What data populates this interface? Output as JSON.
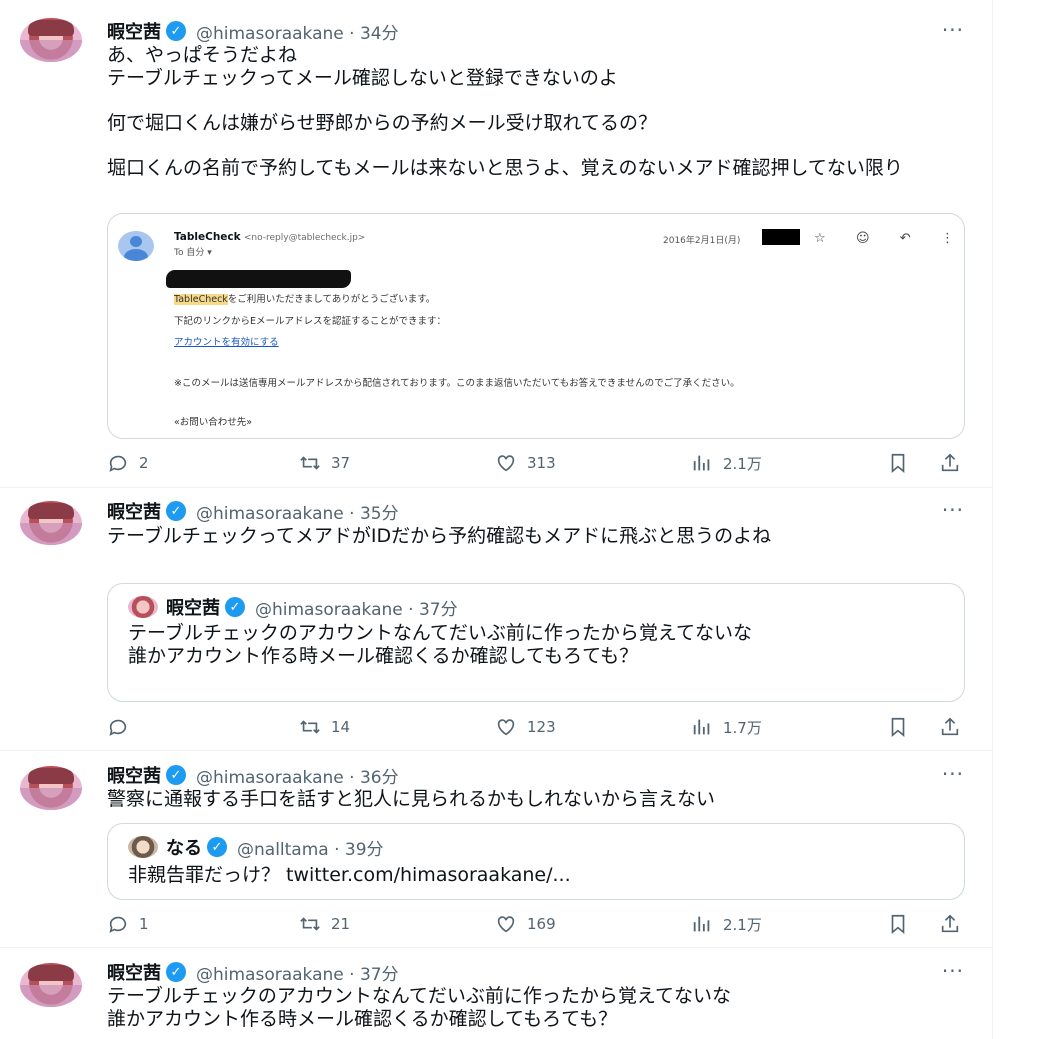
{
  "tweets": [
    {
      "name": "暇空茜",
      "verified": "✓",
      "handle": "@himasoraakane · 34分",
      "more": "···",
      "text": "あ、やっぱそうだよね\nテーブルチェックってメール確認しないと登録できないのよ\n\n何で堀口くんは嫌がらせ野郎からの予約メール受け取れてるの？\n\n堀口くんの名前で予約してもメールは来ないと思うよ、覚えのないメアド確認押してない限り",
      "replies": "2",
      "retweets": "37",
      "likes": "313",
      "views": "2.1万"
    },
    {
      "name": "暇空茜",
      "verified": "✓",
      "handle": "@himasoraakane · 35分",
      "more": "···",
      "text": "テーブルチェックってメアドがIDだから予約確認もメアドに飛ぶと思うのよね",
      "quote": {
        "name": "暇空茜",
        "handle": "@himasoraakane · 37分",
        "text": "テーブルチェックのアカウントなんてだいぶ前に作ったから覚えてないな\n誰かアカウント作る時メール確認くるか確認してもろても？"
      },
      "replies": "",
      "retweets": "14",
      "likes": "123",
      "views": "1.7万"
    },
    {
      "name": "暇空茜",
      "verified": "✓",
      "handle": "@himasoraakane · 36分",
      "more": "···",
      "text": "警察に通報する手口を話すと犯人に見られるかもしれないから言えない",
      "quote": {
        "name": "なる",
        "handle": "@nalltama · 39分",
        "text": "非親告罪だっけ？ twitter.com/himasoraakane/..."
      },
      "replies": "1",
      "retweets": "21",
      "likes": "169",
      "views": "2.1万"
    },
    {
      "name": "暇空茜",
      "verified": "✓",
      "handle": "@himasoraakane · 37分",
      "more": "···",
      "text": "テーブルチェックのアカウントなんてだいぶ前に作ったから覚えてないな\n誰かアカウント作る時メール確認くるか確認してもろても？"
    }
  ],
  "email": {
    "sender_name": "TableCheck",
    "sender_addr": "<no-reply@tablecheck.jp>",
    "to": "To 自分 ▾",
    "date": "2016年2月1日(月)",
    "icons": [
      "☆",
      "☺",
      "↶",
      "⋮"
    ],
    "brand": "TableCheck",
    "greeting_rest": "をご利用いただきましてありがとうございます。",
    "instruction": "下記のリンクからEメールアドレスを認証することができます：",
    "link": "アカウントを有効にする",
    "notice": "※このメールは送信専用メールアドレスから配信されております。このまま返信いただいてもお答えできませんのでご了承ください。",
    "contact": "«お問い合わせ先»"
  },
  "colors": {
    "accent": "#1d9bf0",
    "muted": "#536471",
    "border": "#cfd9de"
  }
}
